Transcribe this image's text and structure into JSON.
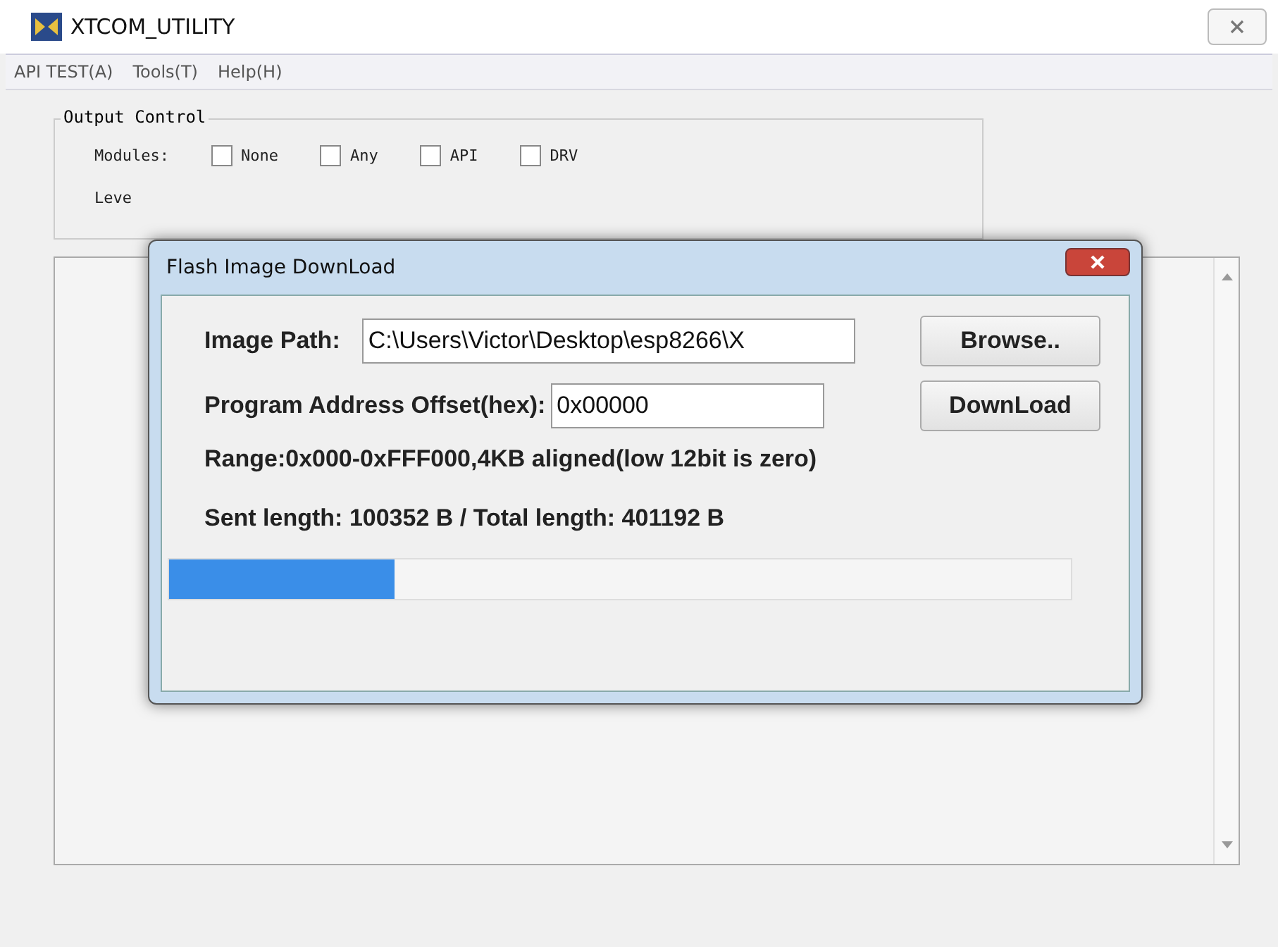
{
  "window": {
    "title": "XTCOM_UTILITY"
  },
  "menu": [
    "API TEST(A)",
    "Tools(T)",
    "Help(H)"
  ],
  "output_control": {
    "title": "Output Control",
    "modules_label": "Modules:",
    "modules": [
      {
        "label": "None",
        "checked": false
      },
      {
        "label": "Any",
        "checked": false
      },
      {
        "label": "API",
        "checked": false
      },
      {
        "label": "DRV",
        "checked": false
      }
    ],
    "level_label": "Leve"
  },
  "dialog": {
    "title": "Flash Image DownLoad",
    "image_path_label": "Image Path:",
    "image_path": "C:\\Users\\Victor\\Desktop\\esp8266\\X",
    "browse": "Browse..",
    "offset_label": "Program Address Offset(hex):",
    "offset": "0x00000",
    "download": "DownLoad",
    "range": "Range:0x000-0xFFF000,4KB aligned(low 12bit is zero)",
    "status": "Sent length: 100352 B / Total length: 401192 B",
    "progress": {
      "level": 0.25
    }
  }
}
